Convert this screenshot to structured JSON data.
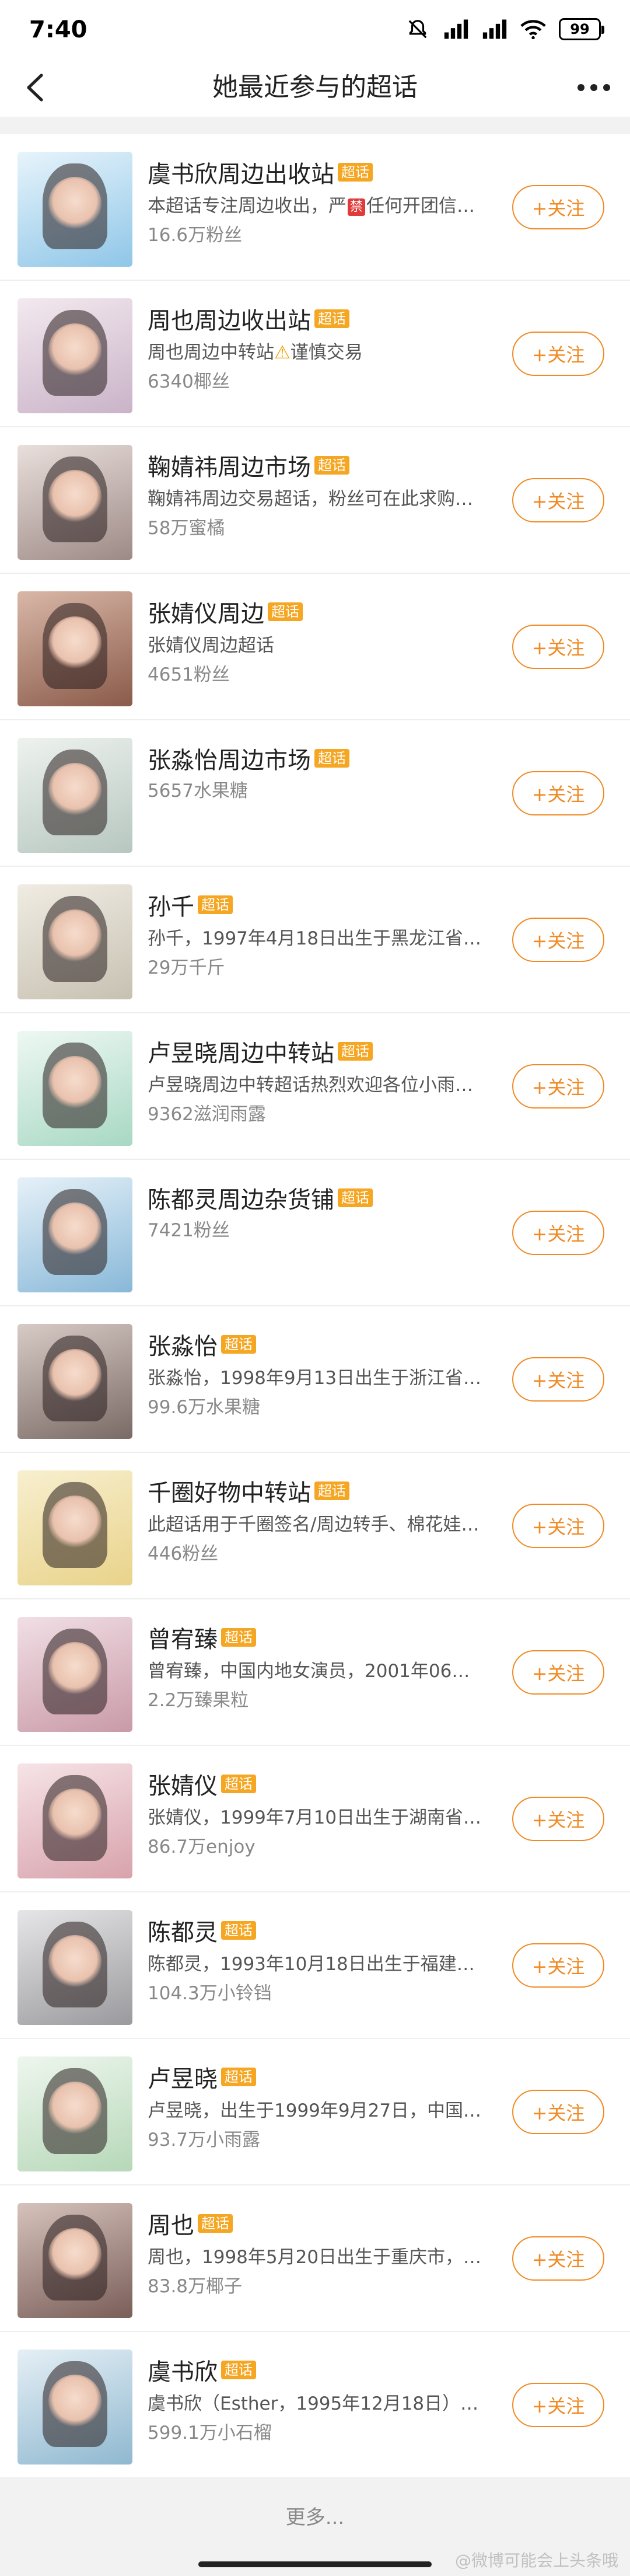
{
  "status_bar": {
    "time": "7:40",
    "battery": "99"
  },
  "nav": {
    "title": "她最近参与的超话"
  },
  "badge_label": "超话",
  "follow_label": "+关注",
  "items": [
    {
      "title": "虞书欣周边出收站",
      "desc_pre": "本超话专注周边收出，严",
      "desc_mark": "禁",
      "desc_post": "任何开团信…",
      "fans": "16.6万粉丝",
      "c1": "#8fc6e8",
      "c2": "#e7f4fb"
    },
    {
      "title": "周也周边收出站",
      "desc_pre": "周也周边中转站",
      "desc_mark": "⚠",
      "desc_post": "谨慎交易",
      "fans": "6340椰丝",
      "c1": "#c9b3c8",
      "c2": "#f3e9ef"
    },
    {
      "title": "鞠婧祎周边市场",
      "desc_pre": "鞠婧祎周边交易超话，粉丝可在此求购…",
      "desc_mark": "",
      "desc_post": "",
      "fans": "58万蜜橘",
      "c1": "#9d8a86",
      "c2": "#e9dfdc"
    },
    {
      "title": "张婧仪周边",
      "desc_pre": "张婧仪周边超话",
      "desc_mark": "",
      "desc_post": "",
      "fans": "4651粉丝",
      "c1": "#8a5a4a",
      "c2": "#d9b7a7"
    },
    {
      "title": "张淼怡周边市场",
      "desc_pre": "",
      "desc_mark": "",
      "desc_post": "",
      "fans": "5657水果糖",
      "c1": "#b7c7c0",
      "c2": "#eef2ef"
    },
    {
      "title": "孙千",
      "desc_pre": "孙千，1997年4月18日出生于黑龙江省…",
      "desc_mark": "",
      "desc_post": "",
      "fans": "29万千斤",
      "c1": "#c7c1b2",
      "c2": "#f0ece3"
    },
    {
      "title": "卢昱晓周边中转站",
      "desc_pre": "卢昱晓周边中转超话热烈欢迎各位小雨…",
      "desc_mark": "",
      "desc_post": "",
      "fans": "9362滋润雨露",
      "c1": "#a8d8c4",
      "c2": "#eef8f3"
    },
    {
      "title": "陈都灵周边杂货铺",
      "desc_pre": "",
      "desc_mark": "",
      "desc_post": "",
      "fans": "7421粉丝",
      "c1": "#88b8d8",
      "c2": "#e6f1f8"
    },
    {
      "title": "张淼怡",
      "desc_pre": "张淼怡，1998年9月13日出生于浙江省…",
      "desc_mark": "",
      "desc_post": "",
      "fans": "99.6万水果糖",
      "c1": "#7a6a66",
      "c2": "#d8cbc6"
    },
    {
      "title": "千圈好物中转站",
      "desc_pre": "此超话用于千圈签名/周边转手、棉花娃…",
      "desc_mark": "",
      "desc_post": "",
      "fans": "446粉丝",
      "c1": "#e9d38a",
      "c2": "#f7efcf"
    },
    {
      "title": "曾宥臻",
      "desc_pre": "曾宥臻，中国内地女演员，2001年06…",
      "desc_mark": "",
      "desc_post": "",
      "fans": "2.2万臻果粒",
      "c1": "#c99aa8",
      "c2": "#f1dfe5"
    },
    {
      "title": "张婧仪",
      "desc_pre": "张婧仪，1999年7月10日出生于湖南省…",
      "desc_mark": "",
      "desc_post": "",
      "fans": "86.7万enjoy",
      "c1": "#d8a2ac",
      "c2": "#f6e4e7"
    },
    {
      "title": "陈都灵",
      "desc_pre": "陈都灵，1993年10月18日出生于福建厦…",
      "desc_mark": "",
      "desc_post": "",
      "fans": "104.3万小铃铛",
      "c1": "#9a9a9e",
      "c2": "#e6e6e8"
    },
    {
      "title": "卢昱晓",
      "desc_pre": "卢昱晓，出生于1999年9月27日，中国…",
      "desc_mark": "",
      "desc_post": "",
      "fans": "93.7万小雨露",
      "c1": "#b6d8b8",
      "c2": "#eef6ee"
    },
    {
      "title": "周也",
      "desc_pre": "周也，1998年5月20日出生于重庆市，…",
      "desc_mark": "",
      "desc_post": "",
      "fans": "83.8万椰子",
      "c1": "#7a5e58",
      "c2": "#d6c2bc"
    },
    {
      "title": "虞书欣",
      "desc_pre": "虞书欣（Esther，1995年12月18日）出…",
      "desc_mark": "",
      "desc_post": "",
      "fans": "599.1万小石榴",
      "c1": "#8fb8d0",
      "c2": "#e5eff5"
    }
  ],
  "more_label": "更多...",
  "watermark": "@微博可能会上头条哦"
}
